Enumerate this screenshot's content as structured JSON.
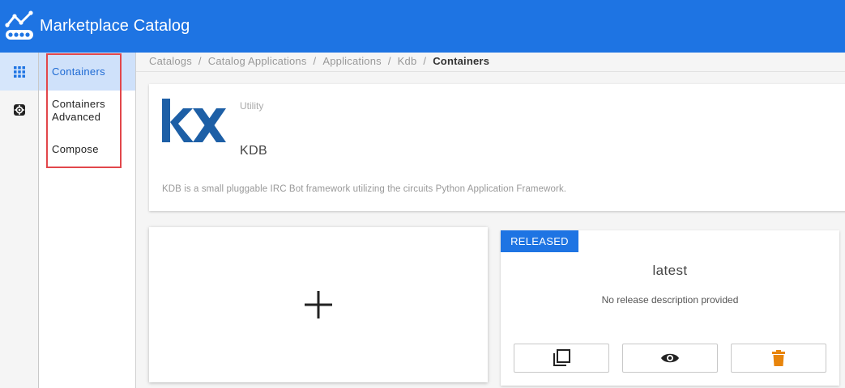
{
  "header": {
    "title": "Marketplace Catalog",
    "logo_icon": "line-chart-conveyor-icon"
  },
  "rail": {
    "items": [
      {
        "icon": "grid-icon",
        "active": true
      },
      {
        "icon": "gear-icon",
        "active": false
      }
    ]
  },
  "subnav": {
    "items": [
      {
        "label": "Containers",
        "active": true
      },
      {
        "label": "Containers Advanced",
        "active": false
      },
      {
        "label": "Compose",
        "active": false
      }
    ]
  },
  "breadcrumb": {
    "items": [
      "Catalogs",
      "Catalog Applications",
      "Applications",
      "Kdb"
    ],
    "current": "Containers",
    "separator": "/"
  },
  "app": {
    "category": "Utility",
    "name": "KDB",
    "description": "KDB is a small pluggable IRC Bot framework utilizing the circuits Python Application Framework.",
    "logo_color": "#1d5fa6"
  },
  "add_card": {
    "icon": "plus-icon"
  },
  "release": {
    "badge": "RELEASED",
    "version": "latest",
    "description": "No release description provided",
    "actions": [
      {
        "icon": "copy-icon"
      },
      {
        "icon": "eye-icon"
      },
      {
        "icon": "trash-icon",
        "color": "#e8850c"
      }
    ]
  },
  "colors": {
    "primary": "#1e74e3",
    "highlight_border": "#e2474b"
  }
}
